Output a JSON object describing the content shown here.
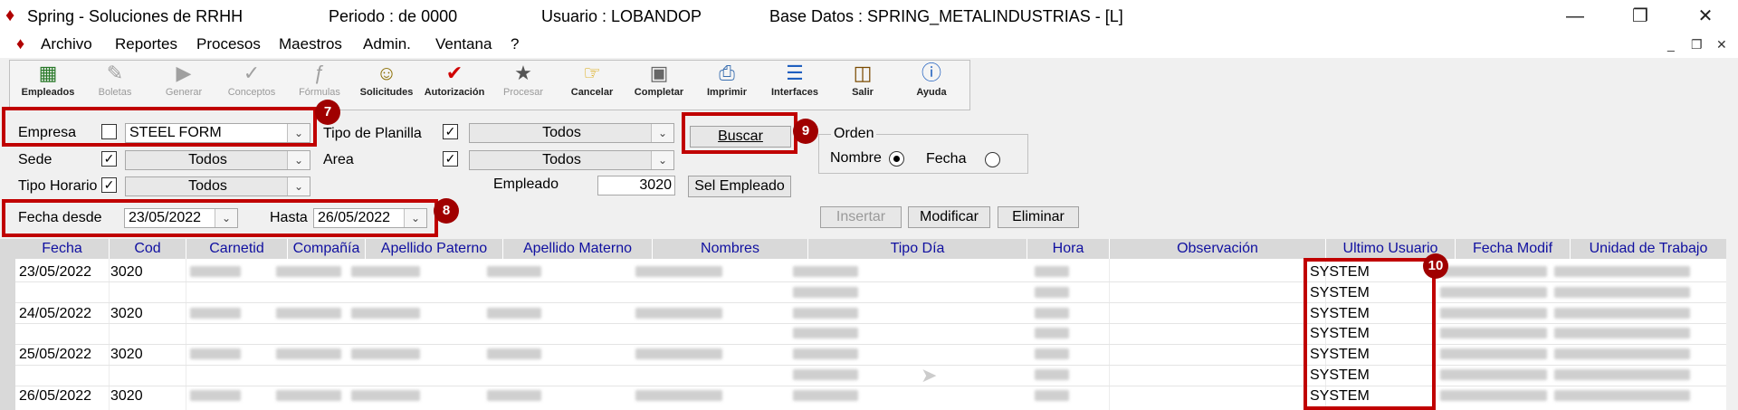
{
  "window": {
    "app_title": "Spring - Soluciones de RRHH",
    "periodo": "Periodo :  de 0000",
    "usuario": "Usuario : LOBANDOP",
    "base_datos": "Base Datos : SPRING_METALINDUSTRIAS - [L]"
  },
  "menu": [
    "Archivo",
    "Reportes",
    "Procesos",
    "Maestros",
    "Admin.",
    "Ventana",
    "?"
  ],
  "toolbar": [
    {
      "label": "Empleados",
      "enabled": true,
      "icon": "employees-icon"
    },
    {
      "label": "Boletas",
      "enabled": false,
      "icon": "payslip-icon"
    },
    {
      "label": "Generar",
      "enabled": false,
      "icon": "generate-icon"
    },
    {
      "label": "Conceptos",
      "enabled": false,
      "icon": "concepts-icon"
    },
    {
      "label": "Fórmulas",
      "enabled": false,
      "icon": "formula-icon"
    },
    {
      "label": "Solicitudes",
      "enabled": true,
      "icon": "requests-icon"
    },
    {
      "label": "Autorización",
      "enabled": true,
      "icon": "checkmark-icon"
    },
    {
      "label": "Procesar",
      "enabled": false,
      "icon": "process-icon"
    },
    {
      "label": "Cancelar",
      "enabled": true,
      "icon": "cancel-icon"
    },
    {
      "label": "Completar",
      "enabled": true,
      "icon": "complete-icon"
    },
    {
      "label": "Imprimir",
      "enabled": true,
      "icon": "printer-icon"
    },
    {
      "label": "Interfaces",
      "enabled": true,
      "icon": "interfaces-icon"
    },
    {
      "label": "Salir",
      "enabled": true,
      "icon": "exit-door-icon"
    },
    {
      "label": "Ayuda",
      "enabled": true,
      "icon": "help-icon"
    }
  ],
  "filters": {
    "empresa_label": "Empresa",
    "empresa_value": "STEEL FORM",
    "tipo_planilla_label": "Tipo de Planilla",
    "tipo_planilla_value": "Todos",
    "sede_label": "Sede",
    "sede_value": "Todos",
    "area_label": "Area",
    "area_value": "Todos",
    "tipo_horario_label": "Tipo Horario",
    "tipo_horario_value": "Todos",
    "empleado_label": "Empleado",
    "empleado_value": "3020",
    "sel_empleado_button": "Sel Empleado",
    "buscar_button": "Buscar",
    "orden_label": "Orden",
    "orden_nombre": "Nombre",
    "orden_fecha": "Fecha",
    "fecha_desde_label": "Fecha desde",
    "fecha_desde_value": "23/05/2022",
    "hasta_label": "Hasta",
    "hasta_value": "26/05/2022",
    "insertar_button": "Insertar",
    "modificar_button": "Modificar",
    "eliminar_button": "Eliminar"
  },
  "annotations": {
    "b7": "7",
    "b8": "8",
    "b9": "9",
    "b10": "10"
  },
  "grid": {
    "columns": [
      "Fecha",
      "Cod",
      "Carnetid",
      "Compañía",
      "Apellido Paterno",
      "Apellido Materno",
      "Nombres",
      "Tipo Día",
      "Hora",
      "Observación",
      "Ultimo Usuario",
      "Fecha Modif",
      "Unidad de Trabajo"
    ],
    "rows": [
      {
        "fecha": "23/05/2022",
        "cod": "3020",
        "usuario": "SYSTEM"
      },
      {
        "fecha": "",
        "cod": "",
        "usuario": "SYSTEM"
      },
      {
        "fecha": "24/05/2022",
        "cod": "3020",
        "usuario": "SYSTEM"
      },
      {
        "fecha": "",
        "cod": "",
        "usuario": "SYSTEM"
      },
      {
        "fecha": "25/05/2022",
        "cod": "3020",
        "usuario": "SYSTEM"
      },
      {
        "fecha": "",
        "cod": "",
        "usuario": "SYSTEM"
      },
      {
        "fecha": "26/05/2022",
        "cod": "3020",
        "usuario": "SYSTEM"
      }
    ]
  },
  "colors": {
    "highlight_red": "#c00000",
    "header_text": "#1010a0"
  }
}
